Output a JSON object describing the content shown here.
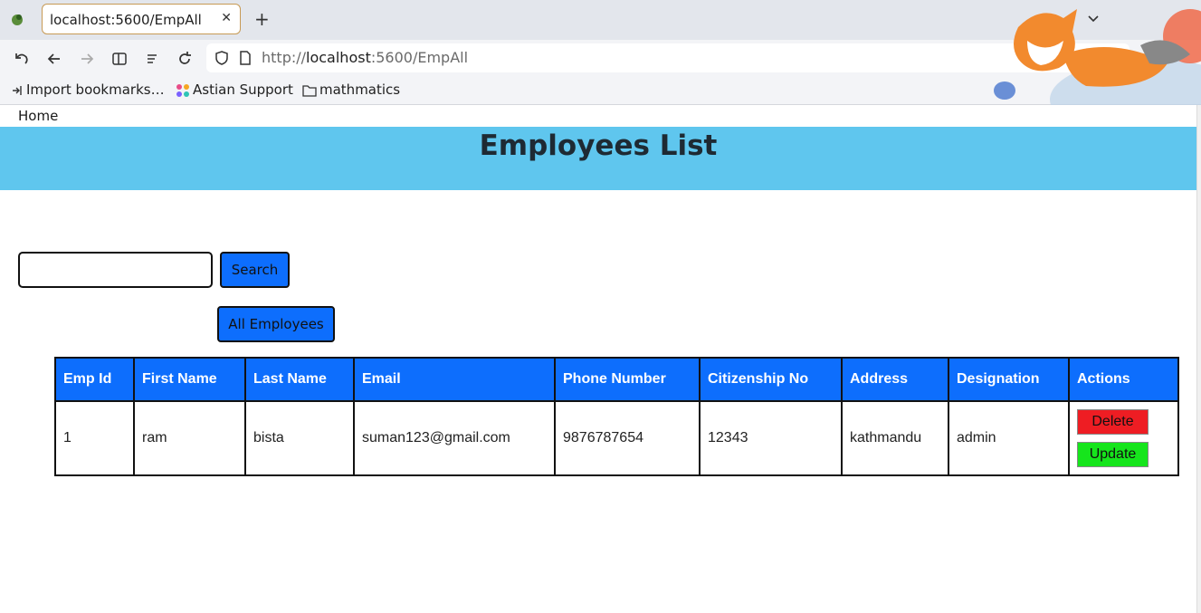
{
  "browser": {
    "tab_title": "localhost:5600/EmpAll",
    "tab_close": "✕",
    "new_tab": "+",
    "url_prefix": "http://",
    "url_host": "localhost",
    "url_rest": ":5600/EmpAll",
    "bookmarks": [
      "Import bookmarks…",
      "Astian Support",
      "mathmatics"
    ]
  },
  "nav": {
    "home": "Home"
  },
  "header": {
    "title": "Employees List"
  },
  "search": {
    "value": "",
    "button_label": "Search"
  },
  "all_employees_label": "All Employees",
  "table": {
    "headers": [
      "Emp Id",
      "First Name",
      "Last Name",
      "Email",
      "Phone Number",
      "Citizenship No",
      "Address",
      "Designation",
      "Actions"
    ],
    "rows": [
      {
        "emp_id": "1",
        "first_name": "ram",
        "last_name": "bista",
        "email": "suman123@gmail.com",
        "phone": "9876787654",
        "citizenship": "12343",
        "address": "kathmandu",
        "designation": "admin"
      }
    ],
    "delete_label": "Delete",
    "update_label": "Update"
  },
  "colors": {
    "header_band": "#5fc6ee",
    "primary": "#0d6efd",
    "delete": "#ee1d23",
    "update": "#16e51c"
  }
}
